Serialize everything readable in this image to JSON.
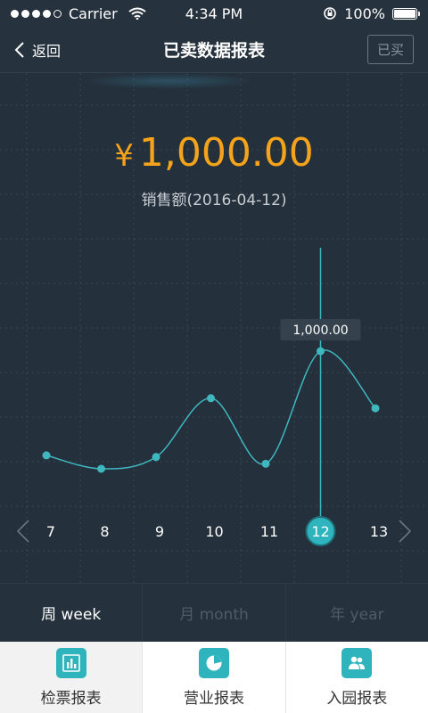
{
  "status_bar": {
    "carrier": "Carrier",
    "time": "4:34 PM",
    "battery": "100%"
  },
  "nav": {
    "back_label": "返回",
    "title": "已卖数据报表",
    "bought_label": "已买"
  },
  "summary": {
    "currency": "¥",
    "amount": "1,000.00",
    "label": "销售额(2016-04-12)"
  },
  "chart_data": {
    "type": "line",
    "x": [
      "7",
      "8",
      "9",
      "10",
      "11",
      "12",
      "13"
    ],
    "values": [
      380,
      300,
      370,
      720,
      330,
      1000,
      660
    ],
    "selected_index": 5,
    "tooltip": "1,000.00",
    "ylim": [
      0,
      1200
    ],
    "line_color": "#3fb7bf",
    "selected_color": "#2fb4bd"
  },
  "period_tabs": [
    {
      "label": "周 week",
      "active": true
    },
    {
      "label": "月 month",
      "active": false
    },
    {
      "label": "年 year",
      "active": false
    }
  ],
  "bottom_tabs": [
    {
      "label": "检票报表",
      "icon": "bar-chart-icon",
      "active": true
    },
    {
      "label": "营业报表",
      "icon": "pie-chart-icon",
      "active": false
    },
    {
      "label": "入园报表",
      "icon": "users-icon",
      "active": false
    }
  ]
}
